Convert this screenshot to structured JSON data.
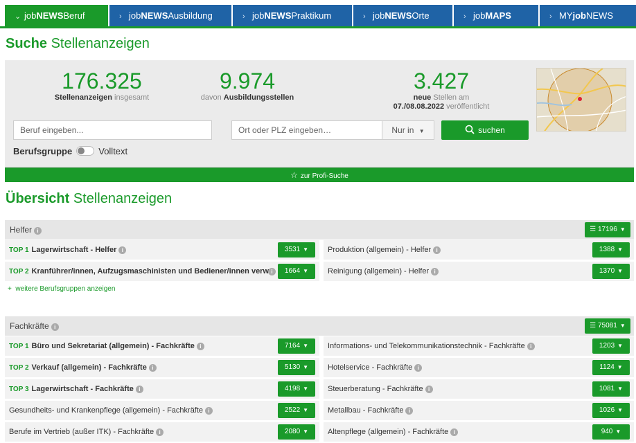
{
  "nav": {
    "tabs": [
      {
        "prefix": "job",
        "bold": "NEWS",
        "suffix": "Beruf",
        "active": true
      },
      {
        "prefix": "job",
        "bold": "NEWS",
        "suffix": "Ausbildung"
      },
      {
        "prefix": "job",
        "bold": "NEWS",
        "suffix": "Praktikum"
      },
      {
        "prefix": "job",
        "bold": "NEWS",
        "suffix": "Orte"
      },
      {
        "prefix": "job",
        "bold": "MAPS",
        "suffix": ""
      },
      {
        "prefix": "MY",
        "bold": "job",
        "suffix": "NEWS"
      }
    ]
  },
  "search": {
    "heading_bold": "Suche",
    "heading_rest": "Stellenanzeigen",
    "stats": [
      {
        "number": "176.325",
        "label_bold": "Stellenanzeigen",
        "label_rest": "insgesamt"
      },
      {
        "number": "9.974",
        "label_pre": "davon",
        "label_bold": "Ausbildungsstellen"
      },
      {
        "number": "3.427",
        "label_bold": "neue",
        "label_rest": "Stellen am",
        "date": "07./08.08.2022",
        "date_rest": "veröffentlicht"
      }
    ],
    "job_placeholder": "Beruf eingeben...",
    "place_placeholder": "Ort oder PLZ eingeben…",
    "mode_select": "Nur in",
    "search_button": "suchen",
    "toggle_left": "Berufsgruppe",
    "toggle_right": "Volltext",
    "profi": "zur Profi-Suche"
  },
  "overview": {
    "heading_bold": "Übersicht",
    "heading_rest": "Stellenanzeigen",
    "groups": [
      {
        "title": "Helfer",
        "total": "17196",
        "left": [
          {
            "top": "TOP 1",
            "label": "Lagerwirtschaft - Helfer",
            "count": "3531"
          },
          {
            "top": "TOP 2",
            "label": "Kranführer/innen, Aufzugsmaschinisten und Bediener/innen verw…",
            "count": "1664"
          }
        ],
        "right": [
          {
            "label": "Produktion (allgemein) - Helfer",
            "count": "1388"
          },
          {
            "label": "Reinigung (allgemein) - Helfer",
            "count": "1370"
          }
        ],
        "more": "weitere Berufsgruppen anzeigen"
      },
      {
        "title": "Fachkräfte",
        "total": "75081",
        "left": [
          {
            "top": "TOP 1",
            "label": "Büro und Sekretariat (allgemein) - Fachkräfte",
            "count": "7164"
          },
          {
            "top": "TOP 2",
            "label": "Verkauf (allgemein) - Fachkräfte",
            "count": "5130"
          },
          {
            "top": "TOP 3",
            "label": "Lagerwirtschaft - Fachkräfte",
            "count": "4198"
          },
          {
            "label": "Gesundheits- und Krankenpflege (allgemein) - Fachkräfte",
            "count": "2522"
          },
          {
            "label": "Berufe im Vertrieb (außer ITK) - Fachkräfte",
            "count": "2080"
          }
        ],
        "right": [
          {
            "label": "Informations- und Telekommunikationstechnik - Fachkräfte",
            "count": "1203"
          },
          {
            "label": "Hotelservice - Fachkräfte",
            "count": "1124"
          },
          {
            "label": "Steuerberatung - Fachkräfte",
            "count": "1081"
          },
          {
            "label": "Metallbau - Fachkräfte",
            "count": "1026"
          },
          {
            "label": "Altenpflege (allgemein) - Fachkräfte",
            "count": "940"
          }
        ]
      }
    ]
  },
  "colors": {
    "brand_green": "#1a9a2a",
    "nav_blue": "#1f63a6"
  }
}
